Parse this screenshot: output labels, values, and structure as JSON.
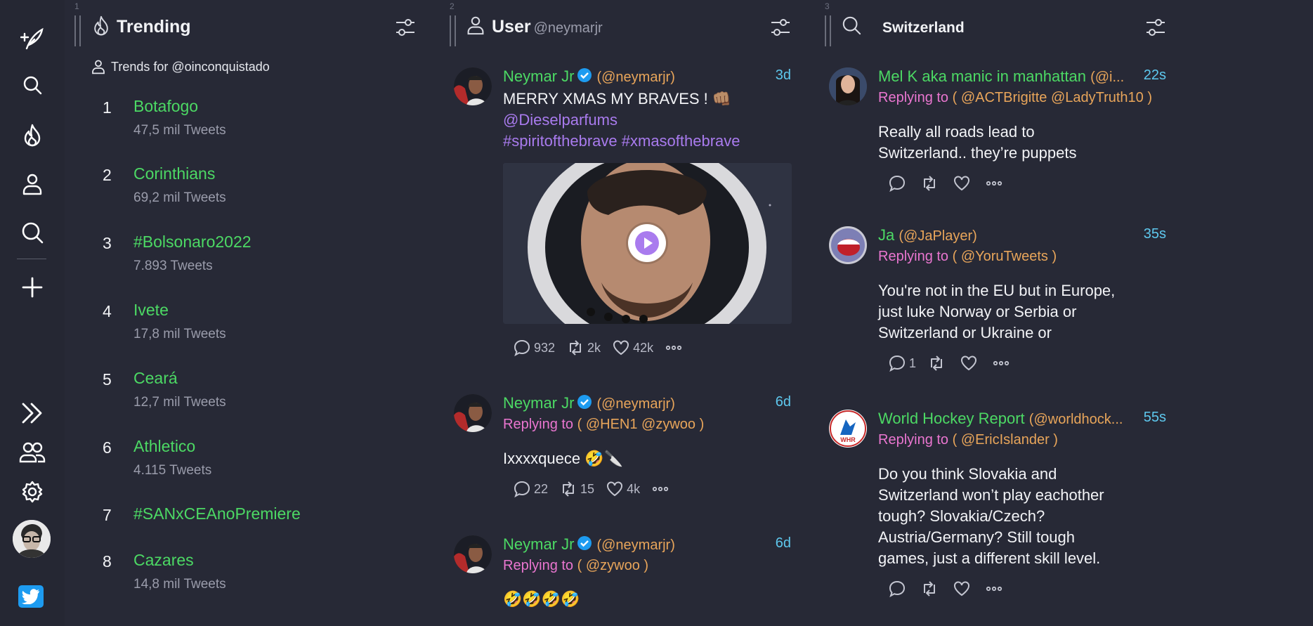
{
  "colors": {
    "name": "#4cd964",
    "handle": "#e8a55a",
    "time": "#5ec8ee",
    "reply": "#ea76d0",
    "hashtag": "#a97bee",
    "bg": "#272936"
  },
  "rail": {
    "icons": [
      "compose-icon",
      "search-icon",
      "trending-icon",
      "user-icon",
      "search-icon",
      "add-icon",
      "collapse-icon",
      "people-icon",
      "gear-icon",
      "avatar",
      "twitter-bird-icon"
    ]
  },
  "columns": [
    {
      "number": "1",
      "title": "Trending",
      "subtitle": ""
    },
    {
      "number": "2",
      "title": "User",
      "subtitle": "@neymarjr"
    },
    {
      "number": "3",
      "title": "Switzerland",
      "subtitle": ""
    }
  ],
  "trending": {
    "trends_for": "Trends for @oinconquistado",
    "items": [
      {
        "rank": "1",
        "name": "Botafogo",
        "count": "47,5 mil Tweets"
      },
      {
        "rank": "2",
        "name": "Corinthians",
        "count": "69,2 mil Tweets"
      },
      {
        "rank": "3",
        "name": "#Bolsonaro2022",
        "count": "7.893 Tweets"
      },
      {
        "rank": "4",
        "name": "Ivete",
        "count": "17,8 mil Tweets"
      },
      {
        "rank": "5",
        "name": "Ceará",
        "count": "12,7 mil Tweets"
      },
      {
        "rank": "6",
        "name": "Athletico",
        "count": "4.115 Tweets"
      },
      {
        "rank": "7",
        "name": "#SANxCEAnoPremiere",
        "count": ""
      },
      {
        "rank": "8",
        "name": "Cazares",
        "count": "14,8 mil Tweets"
      }
    ]
  },
  "user_tweets": [
    {
      "name": "Neymar Jr",
      "handle": "(@neymarjr)",
      "time": "3d",
      "reply_prefix": "",
      "reply_to": "",
      "text_lines": [
        "MERRY XMAS MY BRAVES ! 👊🏽"
      ],
      "tag_lines": [
        "@Dieselparfums",
        "#spiritofthebrave #xmasofthebrave"
      ],
      "replies": "932",
      "retweets": "2k",
      "likes": "42k"
    },
    {
      "name": "Neymar Jr",
      "handle": "(@neymarjr)",
      "time": "6d",
      "reply_prefix": "Replying to",
      "reply_to": "( @HEN1 @zywoo )",
      "text_lines": [
        "Ixxxxquece 🤣🔪"
      ],
      "replies": "22",
      "retweets": "15",
      "likes": "4k"
    },
    {
      "name": "Neymar Jr",
      "handle": "(@neymarjr)",
      "time": "6d",
      "reply_prefix": "Replying to",
      "reply_to": "( @zywoo )",
      "text_lines": [
        "🤣🤣🤣🤣"
      ]
    }
  ],
  "search_tweets": [
    {
      "name": "Mel K aka manic in manhattan",
      "handle": "(@i...",
      "time": "22s",
      "reply_prefix": "Replying to",
      "reply_to": "( @ACTBrigitte @LadyTruth10 )",
      "text_lines": [
        "Really all roads lead to",
        "Switzerland.. they’re puppets"
      ],
      "replies": "",
      "retweets": "",
      "likes": ""
    },
    {
      "name": "Ja",
      "handle": "(@JaPlayer)",
      "time": "35s",
      "reply_prefix": "Replying to",
      "reply_to": "( @YoruTweets )",
      "text_lines": [
        "You're not in the EU but in Europe,",
        "just luke Norway or Serbia or",
        "Switzerland or Ukraine or"
      ],
      "replies": "1",
      "retweets": "",
      "likes": ""
    },
    {
      "name": "World Hockey Report",
      "handle": "(@worldhock...",
      "time": "55s",
      "reply_prefix": "Replying to",
      "reply_to": "( @EricIslander )",
      "text_lines": [
        "Do you think Slovakia and",
        "Switzerland won’t play eachother",
        "tough? Slovakia/Czech?",
        "Austria/Germany? Still tough",
        "games, just a different skill level."
      ],
      "replies": "",
      "retweets": "",
      "likes": "",
      "avatar_text": "WHR"
    }
  ]
}
